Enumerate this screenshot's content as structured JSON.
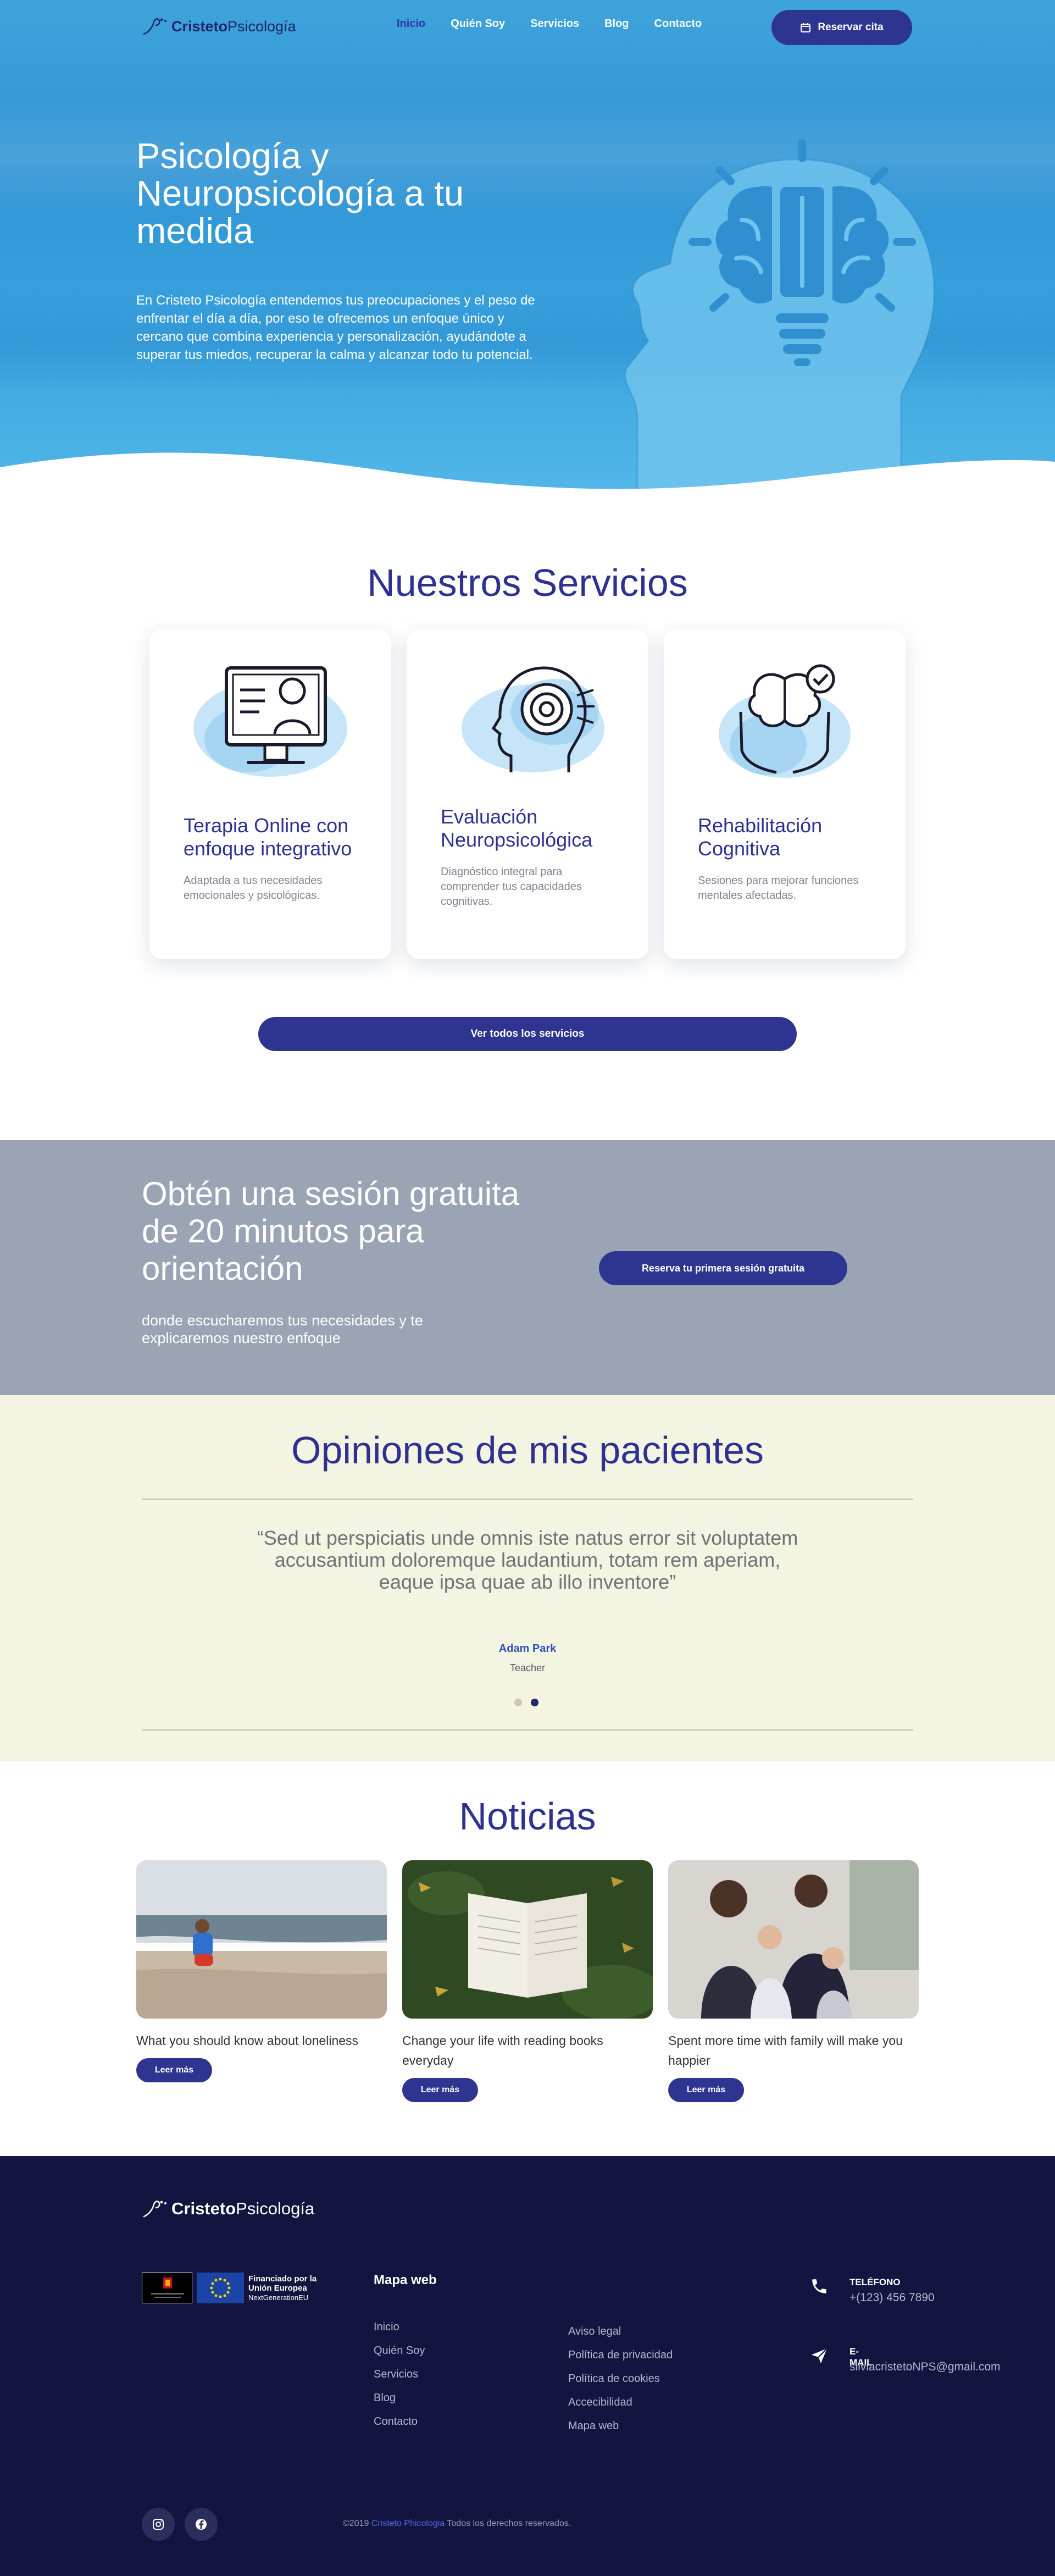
{
  "nav": {
    "logo_bold": "Cristeto",
    "logo_light": "Psicología",
    "items": [
      "Inicio",
      "Quién Soy",
      "Servicios",
      "Blog",
      "Contacto"
    ],
    "active": "Inicio",
    "cta": "Reservar cita"
  },
  "hero": {
    "title": "Psicología y Neuropsicología a tu medida",
    "text": "En Cristeto Psicología entendemos tus preocupaciones y el peso de enfrentar el día a día, por eso te ofrecemos un enfoque único y cercano que combina experiencia y personalización, ayudándote a superar tus miedos, recuperar la calma y alcanzar todo tu potencial."
  },
  "services": {
    "title": "Nuestros Servicios",
    "cards": [
      {
        "title": "Terapia Online con enfoque integrativo",
        "text": "Adaptada a tus necesidades emocionales y psicológicas."
      },
      {
        "title": "Evaluación Neuropsicológica",
        "text": "Diagnóstico integral para comprender tus capacidades cognitivas."
      },
      {
        "title": "Rehabilitación Cognitiva",
        "text": "Sesiones para mejorar funciones mentales afectadas."
      }
    ],
    "button": "Ver todos los servicios"
  },
  "promo": {
    "title": "Obtén una sesión gratuita de 20 minutos para orientación",
    "text": "donde escucharemos tus necesidades y te explicaremos nuestro enfoque",
    "button": "Reserva tu primera sesión gratuita"
  },
  "testimonials": {
    "title": "Opiniones de mis pacientes",
    "quote": "“Sed ut perspiciatis unde omnis iste natus error sit voluptatem accusantium doloremque laudantium, totam rem aperiam, eaque ipsa quae ab illo inventore”",
    "author": "Adam Park",
    "role": "Teacher",
    "slides": 2,
    "active_slide": 2
  },
  "news": {
    "title": "Noticias",
    "posts": [
      {
        "title": "What you should know about loneliness",
        "button": "Leer más"
      },
      {
        "title": "Change your life with reading books everyday",
        "button": "Leer más"
      },
      {
        "title": "Spent more time with family will make you happier",
        "button": "Leer más"
      }
    ]
  },
  "footer": {
    "logo_bold": "Cristeto",
    "logo_light": "Psicología",
    "eu_title": "Financiado por la Unión Europea",
    "eu_sub": "NextGenerationEU",
    "sitemap_title": "Mapa web",
    "col1": [
      "Inicio",
      "Quién Soy",
      "Servicios",
      "Blog",
      "Contacto"
    ],
    "col2": [
      "Aviso legal",
      "Política de privacidad",
      "Política de cookies",
      "Accecibilidad",
      "Mapa web"
    ],
    "phone_label": "TELÉFONO",
    "phone": "+(123) 456 7890",
    "email_label": "E-MAIL",
    "email": "silviacristetoNPS@gmail.com",
    "copy_pre": "©2019 ",
    "copy_brand": "Cristeto Phicologia",
    "copy_post": " Todos los derechos reservados."
  },
  "colors": {
    "primary": "#2d3590",
    "hero_blue": "#3ba3dc",
    "promo_gray": "#9aa4b4",
    "testimonial_bg": "#f4f4e2",
    "footer_bg": "#131540"
  }
}
